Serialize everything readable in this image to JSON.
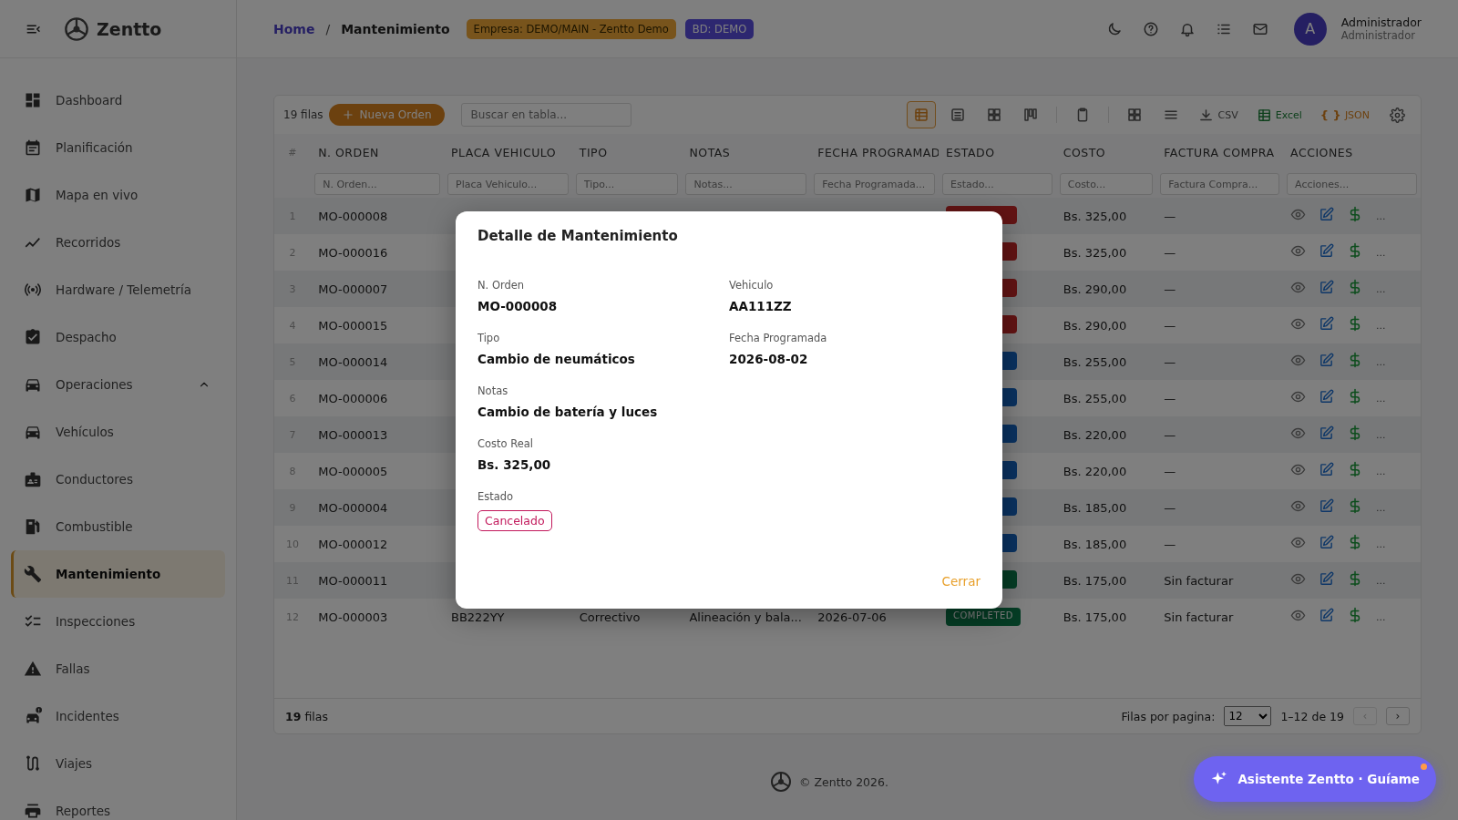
{
  "header": {
    "brand": "Zentto",
    "breadcrumb": [
      {
        "label": "Home",
        "kind": "link"
      },
      {
        "label": "/",
        "kind": "separator"
      },
      {
        "label": "Mantenimiento",
        "kind": "current"
      }
    ],
    "chips": [
      {
        "label": "Empresa: DEMO/MAIN - Zentto Demo",
        "kind": "company"
      },
      {
        "label": "BD: DEMO",
        "kind": "database"
      }
    ],
    "user": {
      "initial": "A",
      "name": "Administrador",
      "role": "Administrador"
    }
  },
  "sidebar": {
    "items": [
      {
        "label": "Dashboard",
        "selected": false
      },
      {
        "label": "Planificación",
        "selected": false
      },
      {
        "label": "Mapa en vivo",
        "selected": false
      },
      {
        "label": "Recorridos",
        "selected": false
      },
      {
        "label": "Hardware / Telemetría",
        "selected": false
      },
      {
        "label": "Despacho",
        "selected": false
      },
      {
        "label": "Operaciones",
        "selected": false,
        "expanded": true,
        "children": [
          {
            "label": "Vehículos",
            "selected": false
          },
          {
            "label": "Conductores",
            "selected": false
          },
          {
            "label": "Combustible",
            "selected": false
          },
          {
            "label": "Mantenimiento",
            "selected": true
          },
          {
            "label": "Inspecciones",
            "selected": false
          },
          {
            "label": "Fallas",
            "selected": false
          },
          {
            "label": "Incidentes",
            "selected": false
          },
          {
            "label": "Viajes",
            "selected": false
          },
          {
            "label": "Reportes",
            "selected": false
          }
        ]
      }
    ]
  },
  "table": {
    "count": "19 filas",
    "new_button": "Nueva Orden",
    "search": {
      "placeholder": "Buscar en tabla..."
    },
    "views": [
      {
        "selected": true
      },
      {
        "selected": false
      },
      {
        "selected": false
      },
      {
        "selected": false
      }
    ],
    "exports": [
      {
        "kind": "csv",
        "label": "CSV"
      },
      {
        "kind": "excel",
        "label": "Excel"
      },
      {
        "kind": "json",
        "icon": "{ }",
        "label": "JSON"
      }
    ],
    "columns": [
      "#",
      "N. ORDEN",
      "PLACA VEHICULO",
      "TIPO",
      "NOTAS",
      "FECHA PROGRAMAD",
      "ESTADO",
      "COSTO",
      "FACTURA COMPRA",
      "ACCIONES"
    ],
    "filters": [
      {
        "placeholder": "N. Orden..."
      },
      {
        "placeholder": "Placa Vehiculo..."
      },
      {
        "placeholder": "Tipo..."
      },
      {
        "placeholder": "Notas..."
      },
      {
        "placeholder": "Fecha Programada..."
      },
      {
        "placeholder": "Estado..."
      },
      {
        "placeholder": "Costo..."
      },
      {
        "placeholder": "Factura Compra..."
      },
      {
        "placeholder": "Acciones..."
      }
    ],
    "rows": [
      {
        "num": "1",
        "order": "MO-000008",
        "cost": "Bs. 325,00",
        "invoice": "—",
        "status": {
          "kind": "cancelled"
        },
        "more": "..."
      },
      {
        "num": "2",
        "order": "MO-000016",
        "cost": "Bs. 325,00",
        "invoice": "—",
        "status": {
          "kind": "cancelled"
        },
        "more": "..."
      },
      {
        "num": "3",
        "order": "MO-000007",
        "cost": "Bs. 290,00",
        "invoice": "—",
        "status": {
          "kind": "cancelled"
        },
        "more": "..."
      },
      {
        "num": "4",
        "order": "MO-000015",
        "cost": "Bs. 290,00",
        "invoice": "—",
        "status": {
          "kind": "cancelled"
        },
        "more": "..."
      },
      {
        "num": "5",
        "order": "MO-000014",
        "cost": "Bs. 255,00",
        "invoice": "—",
        "status": {
          "kind": "scheduled"
        },
        "more": "..."
      },
      {
        "num": "6",
        "order": "MO-000006",
        "cost": "Bs. 255,00",
        "invoice": "—",
        "status": {
          "kind": "scheduled"
        },
        "more": "..."
      },
      {
        "num": "7",
        "order": "MO-000013",
        "cost": "Bs. 220,00",
        "invoice": "—",
        "status": {
          "kind": "scheduled"
        },
        "more": "..."
      },
      {
        "num": "8",
        "order": "MO-000005",
        "cost": "Bs. 220,00",
        "invoice": "—",
        "status": {
          "kind": "scheduled"
        },
        "more": "..."
      },
      {
        "num": "9",
        "order": "MO-000004",
        "cost": "Bs. 185,00",
        "invoice": "—",
        "status": {
          "kind": "scheduled"
        },
        "more": "..."
      },
      {
        "num": "10",
        "order": "MO-000012",
        "cost": "Bs. 185,00",
        "invoice": "—",
        "status": {
          "kind": "scheduled"
        },
        "more": "..."
      },
      {
        "num": "11",
        "order": "MO-000011",
        "cost": "Bs. 175,00",
        "invoice": "Sin facturar",
        "status": {
          "kind": "completed"
        },
        "more": "..."
      },
      {
        "num": "12",
        "order": "MO-000003",
        "plate": "BB222YY",
        "type": "Correctivo",
        "notes": "Alineación y bala...",
        "date": "2026-07-06",
        "cost": "Bs. 175,00",
        "invoice": "Sin facturar",
        "status": {
          "label": "COMPLETED",
          "kind": "completed"
        },
        "more": "..."
      }
    ],
    "footer": {
      "total": "**19** filas",
      "per_page_label": "Filas por pagina:",
      "per_page": "12",
      "range": "1–12 de 19",
      "prev": {
        "label": "‹",
        "disabled": true
      },
      "next": {
        "label": "›",
        "disabled": false
      }
    }
  },
  "modal": {
    "title": "Detalle de Mantenimiento",
    "rows": [
      [
        {
          "label": "N. Orden",
          "value": "MO-000008",
          "kind": "text"
        },
        {
          "label": "Vehiculo",
          "value": "AA111ZZ",
          "kind": "text"
        }
      ],
      [
        {
          "label": "Tipo",
          "value": "Cambio de neumáticos",
          "kind": "text"
        },
        {
          "label": "Fecha Programada",
          "value": "2026-08-02",
          "kind": "text"
        }
      ],
      [
        {
          "label": "Notas",
          "value": "Cambio de batería y luces",
          "kind": "text"
        }
      ],
      [
        {
          "label": "Costo Real",
          "value": "Bs. 325,00",
          "kind": "text"
        }
      ],
      [
        {
          "label": "Estado",
          "value": "Cancelado",
          "kind": "badge",
          "color": "#c2185b"
        }
      ]
    ],
    "close_button": "Cerrar"
  },
  "footer": {
    "copyright": "© Zentto 2026."
  },
  "assistant": {
    "label": "Asistente Zentto · Guíame",
    "notification": true
  }
}
